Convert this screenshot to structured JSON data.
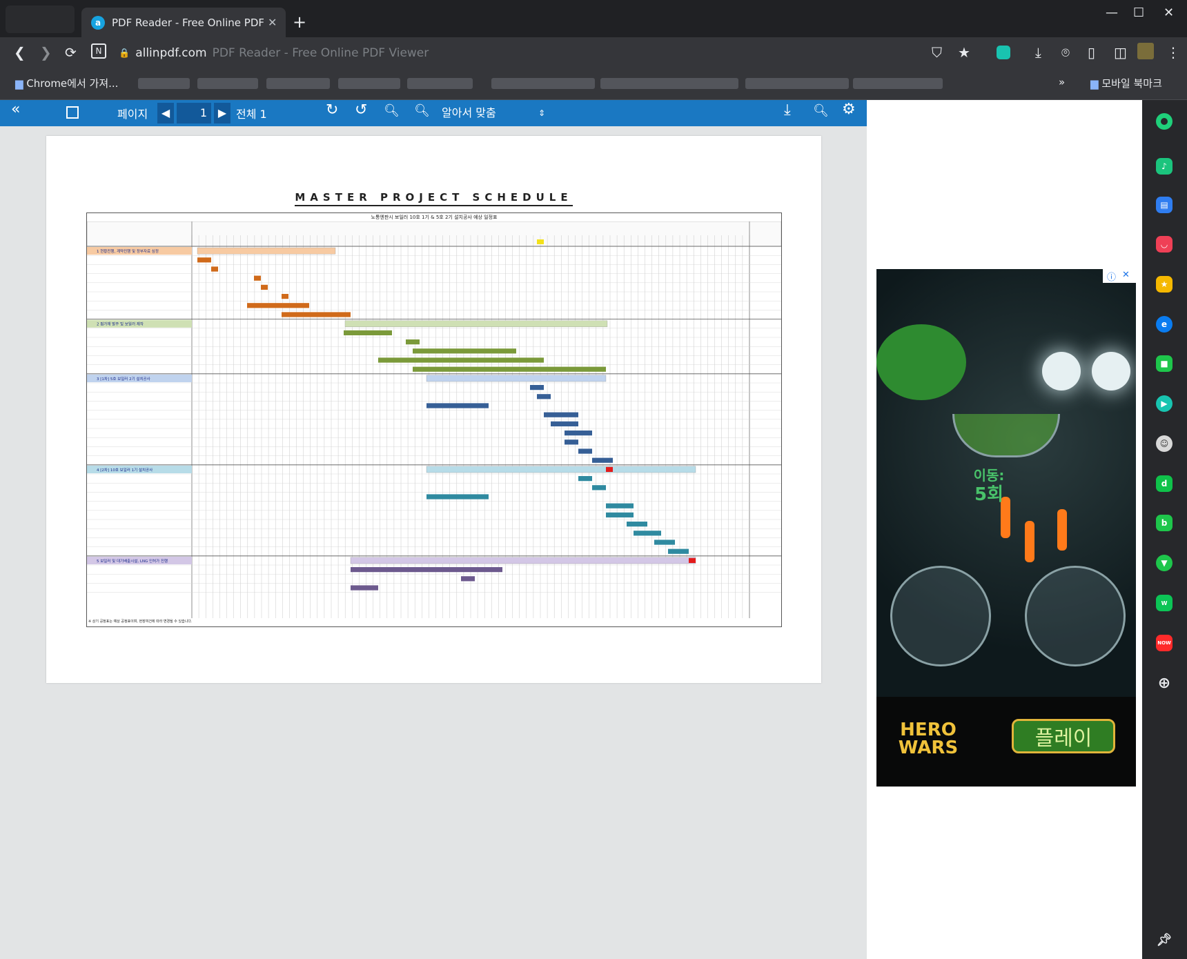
{
  "browser": {
    "tab_title": "PDF Reader - Free Online PDF V",
    "new_tab": "+",
    "window_controls": {
      "minimize": "—",
      "maximize": "☐",
      "close": "✕"
    },
    "address": {
      "host": "allinpdf.com",
      "page_title": "PDF Reader - Free Online PDF Viewer"
    },
    "bookmarks": {
      "first": "Chrome에서 가져...",
      "more": "»",
      "mobile": "모바일 북마크"
    }
  },
  "pdf_toolbar": {
    "page_label": "페이지",
    "page_value": "1",
    "total_label": "전체 1",
    "zoom_mode": "알아서 맞춤"
  },
  "document": {
    "title": "MASTER PROJECT SCHEDULE",
    "table_title": "노통엔판시 보일러 10호 1기 & 5호 2기 설치공사 예상 일정표",
    "sections": [
      {
        "no": "1",
        "label": "현황진행, 계약진행 및 정부자료 심정"
      },
      {
        "no": "2",
        "label": "펌가재 발주 및 보일러 제작"
      },
      {
        "no": "3",
        "label": "[1차] 5호 보일러 2기 설치공사"
      },
      {
        "no": "4",
        "label": "[2차] 10호 보일러 1기 설치공사"
      },
      {
        "no": "5",
        "label": "보일러 및 대기배출시설, LNG 인허가 진행"
      }
    ],
    "footnote": "※ 상기 공정표는 예상 공정표이며, 현장여건에 따라 변경될 수 있습니다."
  },
  "ad": {
    "moves_label": "이동:",
    "moves_value": "5회",
    "brand": "HERO WARS",
    "cta": "플레이"
  }
}
